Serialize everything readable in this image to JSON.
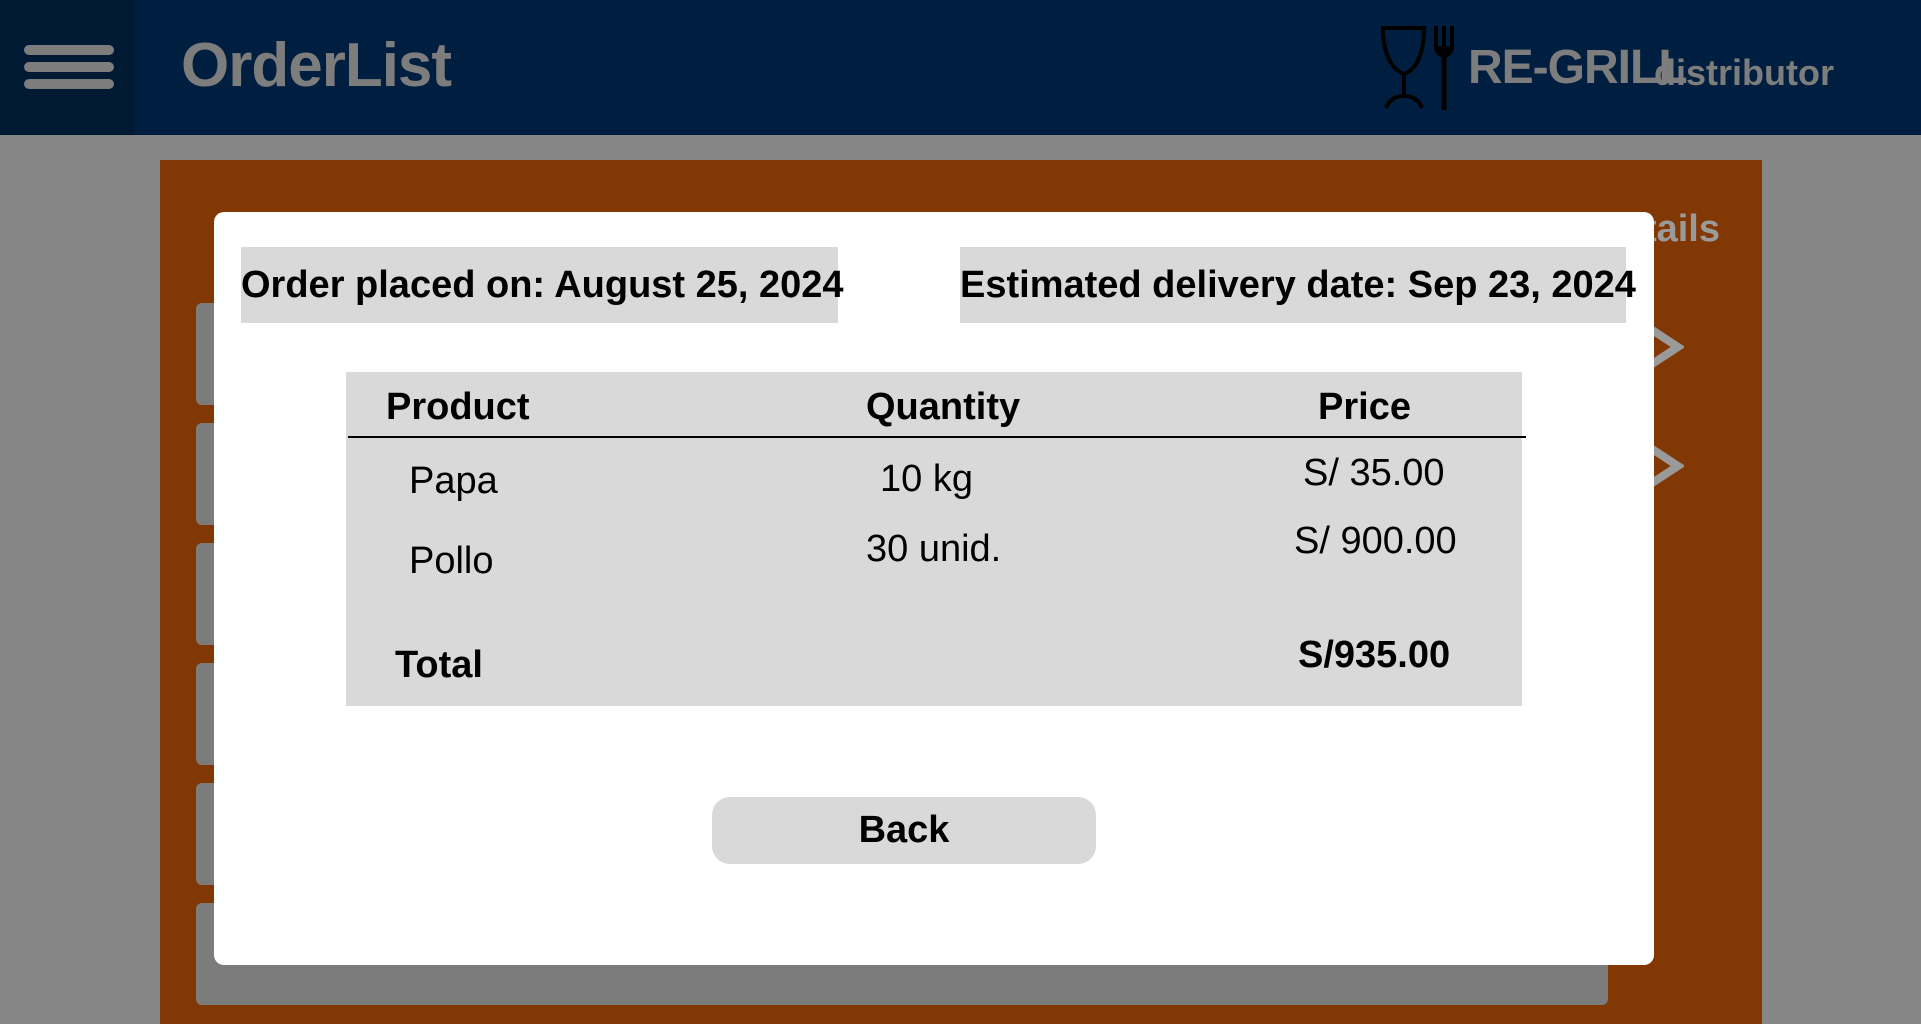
{
  "header": {
    "title": "OrderList",
    "menu_icon": "hamburger-menu-icon",
    "brand": {
      "icon": "glass-fork-icon",
      "name": "RE-GRILL",
      "subtitle": "distributor"
    }
  },
  "background": {
    "panel_title_partial": "tails",
    "chevron_icon": "chevron-right-icon"
  },
  "modal": {
    "order_placed": "Order placed on: August 25, 2024",
    "estimated_delivery": "Estimated delivery date: Sep 23, 2024",
    "table": {
      "headers": {
        "product": "Product",
        "quantity": "Quantity",
        "price": "Price"
      },
      "rows": [
        {
          "product": "Papa",
          "quantity": "10 kg",
          "price": "S/ 35.00"
        },
        {
          "product": "Pollo",
          "quantity": "30 unid.",
          "price": "S/ 900.00"
        }
      ],
      "total_label": "Total",
      "total_value": "S/935.00"
    },
    "back_label": "Back"
  },
  "colors": {
    "topbar": "#001f40",
    "panel": "#823804",
    "overlay": "#868686",
    "modal_box": "#d9d9d9"
  }
}
